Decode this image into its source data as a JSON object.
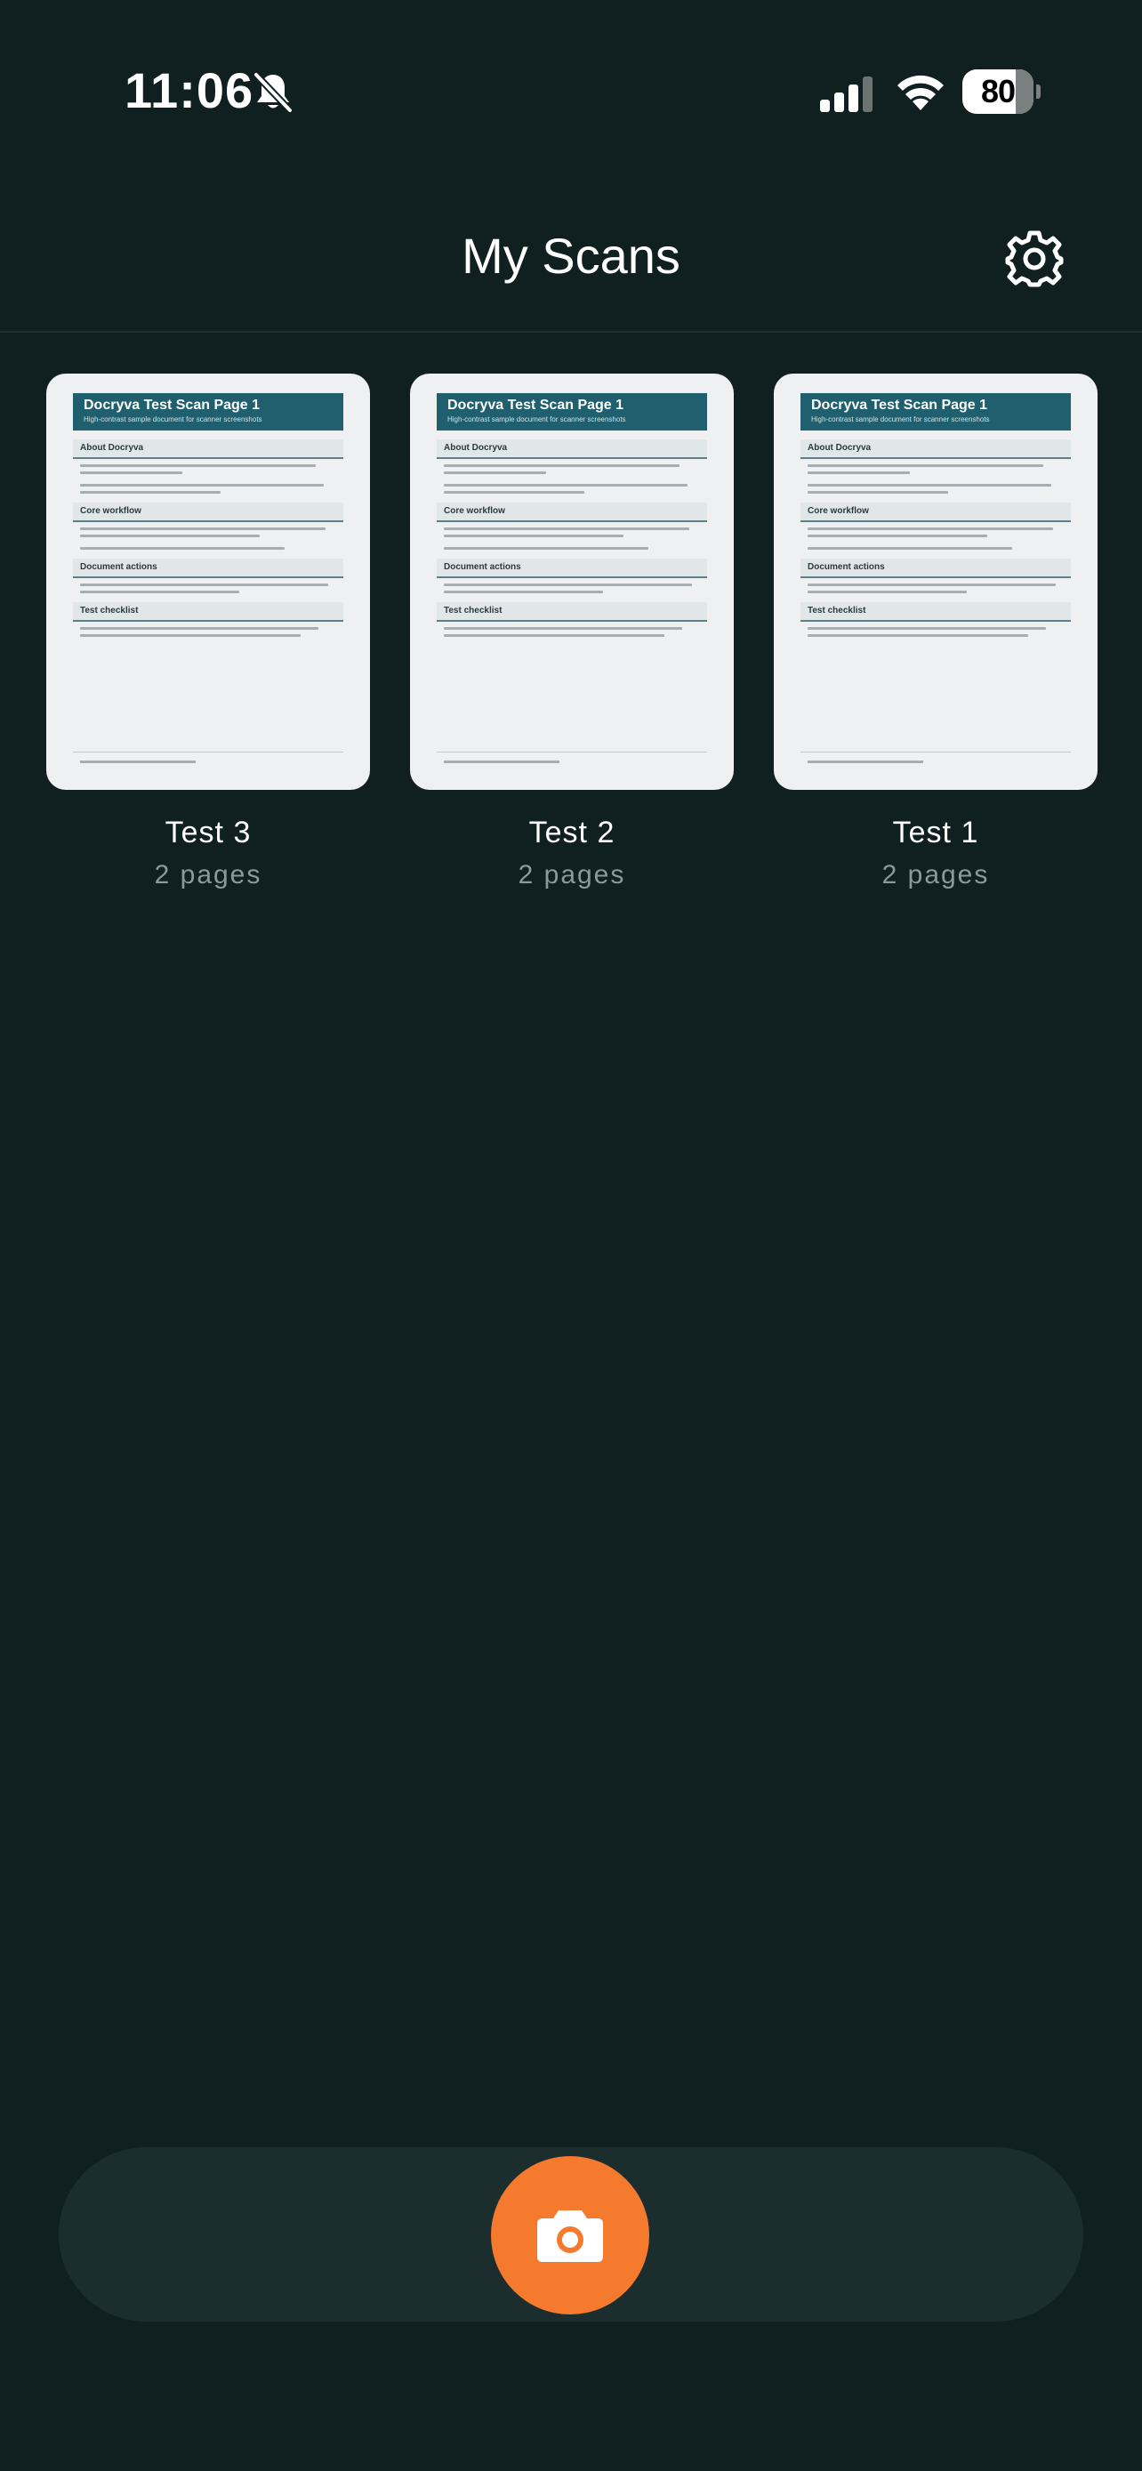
{
  "status_bar": {
    "time": "11:06",
    "battery_level": "80"
  },
  "header": {
    "title": "My Scans"
  },
  "scans": [
    {
      "name": "Test 3",
      "pages": "2 pages",
      "thumbnail": {
        "title": "Docryva Test Scan Page 1",
        "subtitle": "High-contrast sample document for scanner screenshots",
        "sections": [
          "About Docryva",
          "Core workflow",
          "Document actions",
          "Test checklist"
        ]
      }
    },
    {
      "name": "Test 2",
      "pages": "2 pages",
      "thumbnail": {
        "title": "Docryva Test Scan Page 1",
        "subtitle": "High-contrast sample document for scanner screenshots",
        "sections": [
          "About Docryva",
          "Core workflow",
          "Document actions",
          "Test checklist"
        ]
      }
    },
    {
      "name": "Test 1",
      "pages": "2 pages",
      "thumbnail": {
        "title": "Docryva Test Scan Page 1",
        "subtitle": "High-contrast sample document for scanner screenshots",
        "sections": [
          "About Docryva",
          "Core workflow",
          "Document actions",
          "Test checklist"
        ]
      }
    }
  ],
  "icons": {
    "status": [
      "bell-slash-icon",
      "cellular-signal-icon",
      "wifi-icon",
      "battery-icon"
    ],
    "settings": "gear-icon",
    "capture": "camera-icon"
  },
  "colors": {
    "background": "#101f1f",
    "bottom_bar": "#1c2d2d",
    "accent": "#f57a2e",
    "doc_banner": "#1f5f6e",
    "secondary_text": "#8a9a9a"
  }
}
